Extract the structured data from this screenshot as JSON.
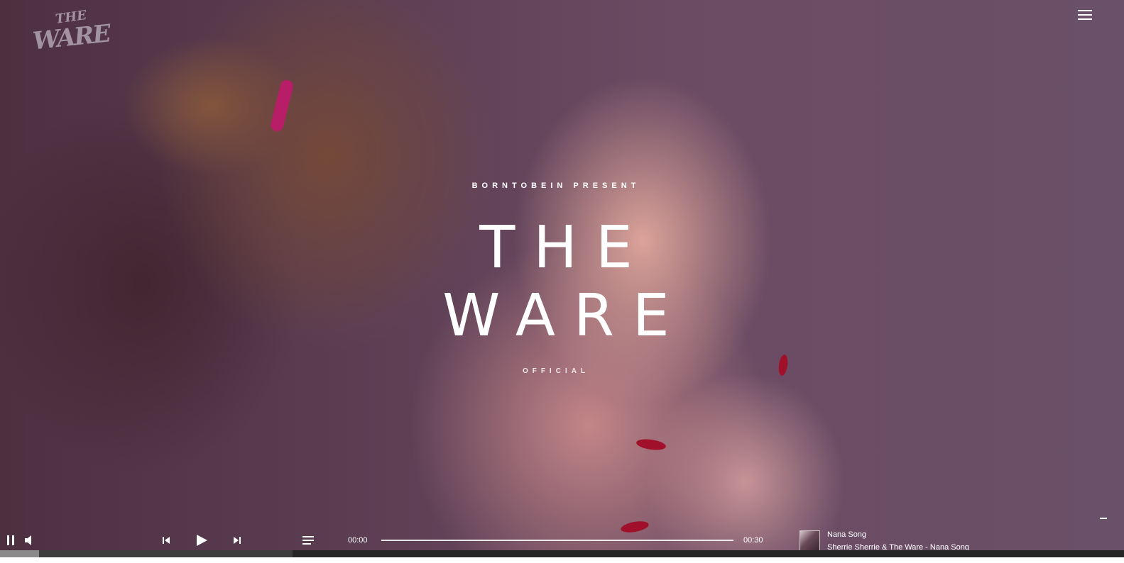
{
  "header": {
    "logo_text_top": "THE",
    "logo_text_bottom": "WARE",
    "menu_icon": "hamburger-menu-icon"
  },
  "hero": {
    "presents": "BORNTOBEIN PRESENT",
    "title_line1": "THE",
    "title_line2": "WARE",
    "subtitle": "OFFICIAL"
  },
  "player": {
    "icons": {
      "pause": "pause-icon",
      "volume": "volume-icon",
      "previous": "previous-track-icon",
      "play": "play-icon",
      "next": "next-track-icon",
      "playlist": "playlist-icon"
    },
    "current_time": "00:00",
    "total_time": "00:30",
    "track_title": "Nana Song",
    "track_artist": "Sherrie Sherrie & The Ware - Nana Song",
    "progress_fraction": 0.0,
    "buffer_fraction": 0.26,
    "volume_fraction": 0.035
  },
  "colors": {
    "text": "#ffffff",
    "player_strip": "#1e1e1e",
    "hair_tie": "#c0196b"
  }
}
